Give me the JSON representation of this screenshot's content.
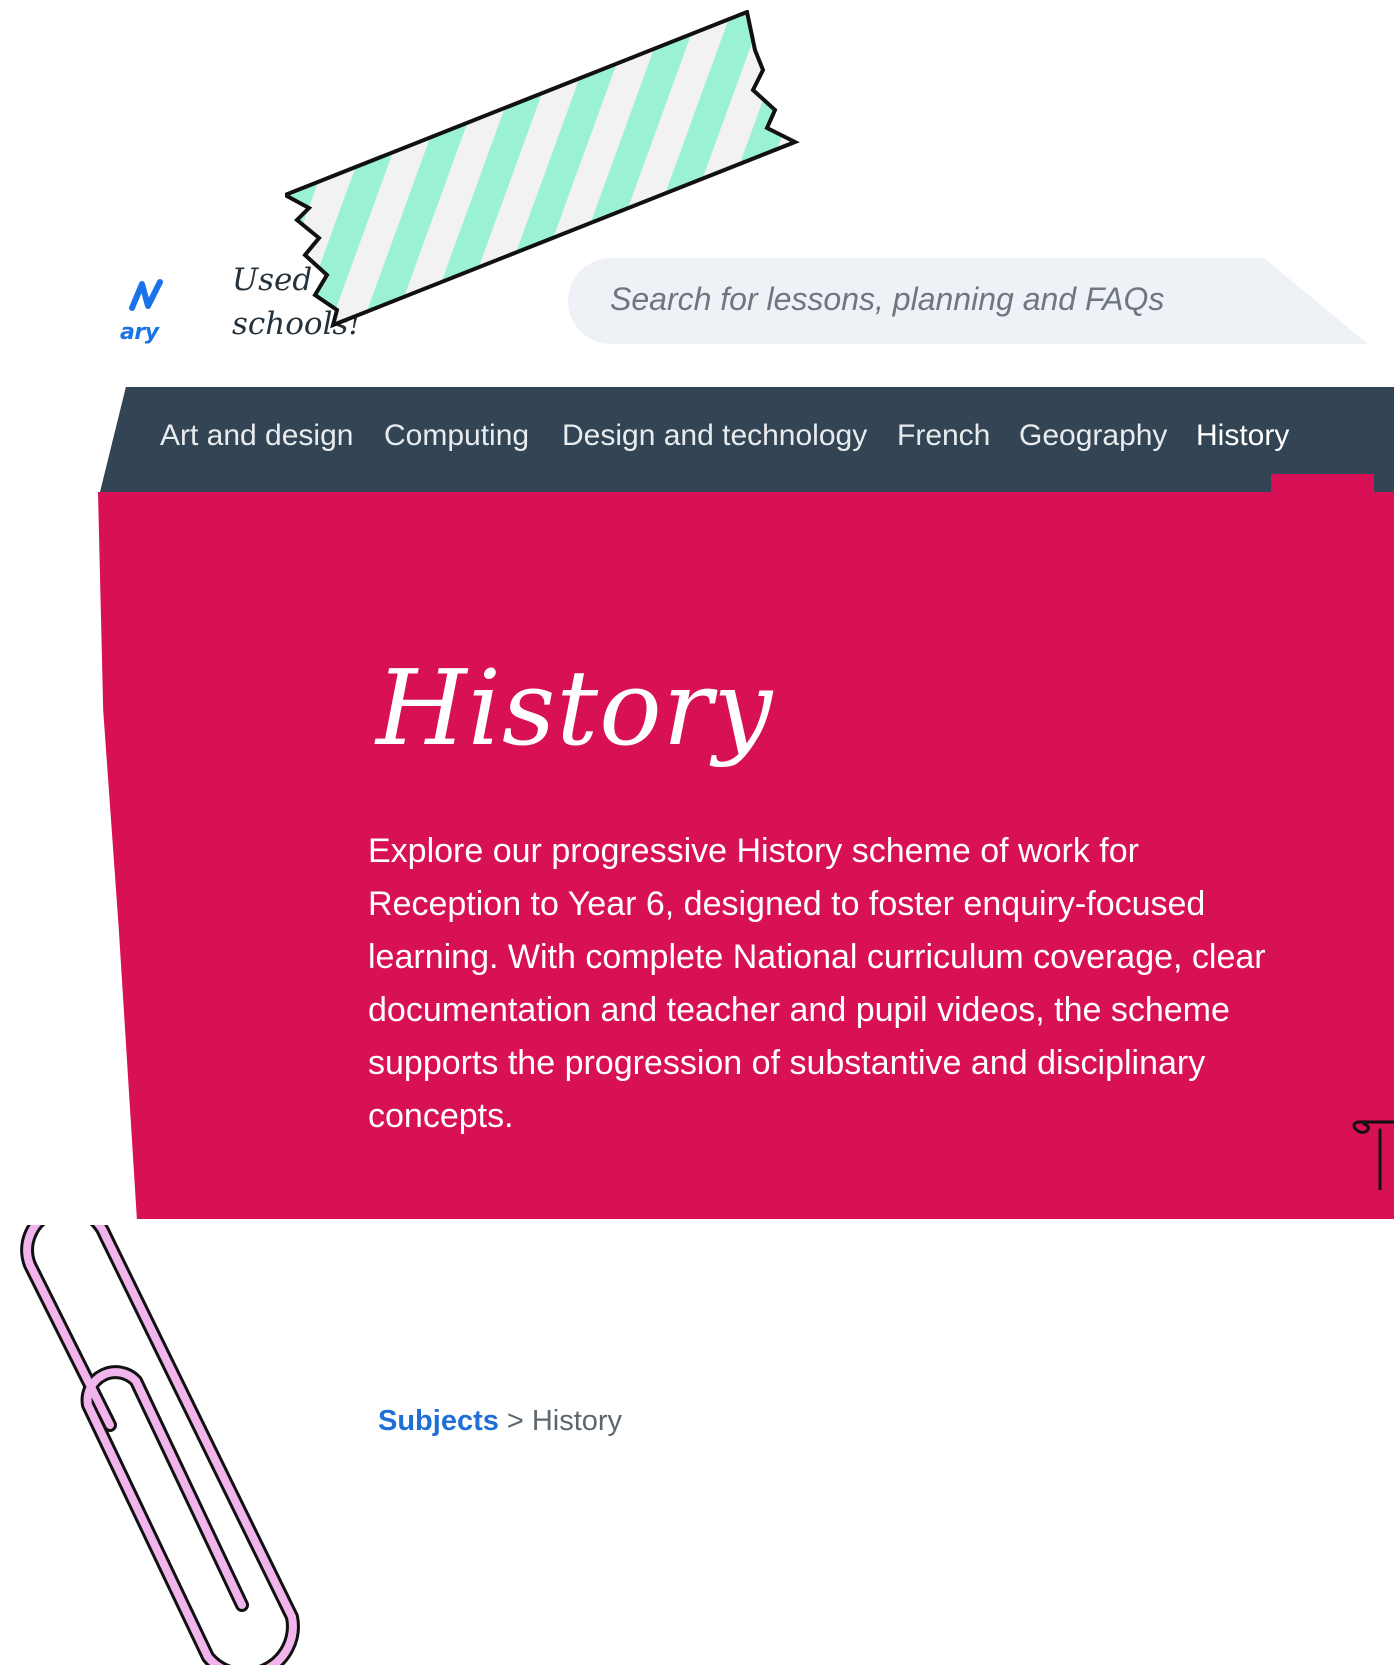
{
  "header": {
    "logo_text": "ary",
    "tagline_line1": "Used in",
    "tagline_line2": "schools!"
  },
  "search": {
    "placeholder": "Search for lessons, planning and FAQs"
  },
  "nav": {
    "items": [
      {
        "label": "Art and design"
      },
      {
        "label": "Computing"
      },
      {
        "label": "Design and technology"
      },
      {
        "label": "French"
      },
      {
        "label": "Geography"
      },
      {
        "label": "History",
        "active": true
      }
    ]
  },
  "hero": {
    "title": "History",
    "description": "Explore our progressive History scheme of work for Reception to Year 6, designed to foster enquiry-focused learning. With complete National curriculum coverage, clear documentation and teacher and pupil videos, the scheme supports the progression of substantive and disciplinary concepts.",
    "background_color": "#d81055"
  },
  "breadcrumb": {
    "link": "Subjects",
    "separator": ">",
    "current": "History"
  },
  "colors": {
    "nav_bg": "#334554",
    "accent": "#d81055",
    "link": "#1f6fd6",
    "tape_stripe": "#9af2d3",
    "clip": "#f1b4ec"
  },
  "icons": {
    "logo": "brand-logo-icon",
    "tape": "washi-tape-decoration",
    "clip": "paperclip-decoration"
  }
}
